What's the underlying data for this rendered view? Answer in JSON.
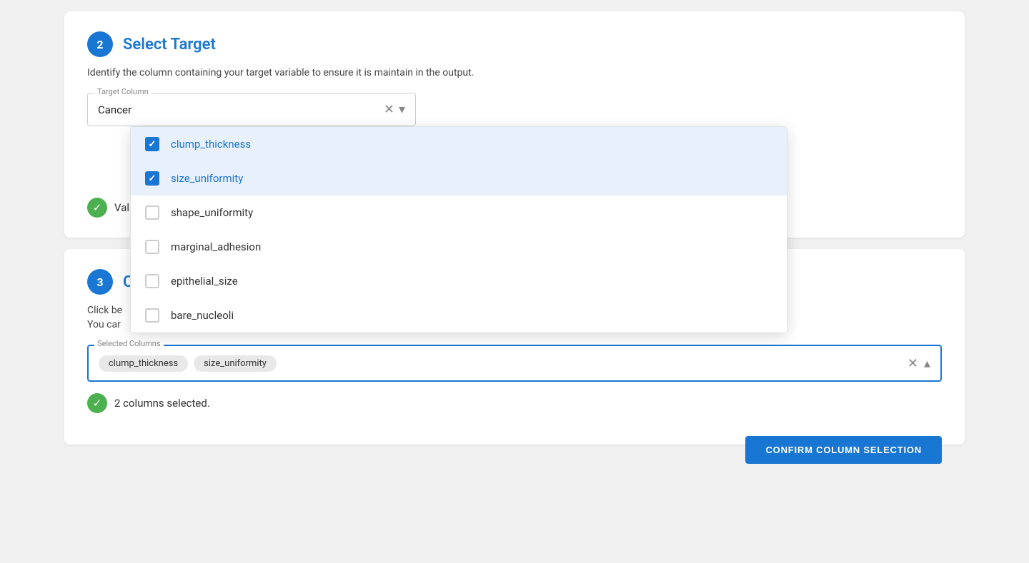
{
  "page": {
    "background": "#f0f0f0"
  },
  "section2": {
    "step_number": "2",
    "title": "Select Target",
    "description": "Identify the column containing your target variable to ensure it is maintain in the output.",
    "target_column_label": "Target Column",
    "target_column_value": "Cancer",
    "validation_text": "Val"
  },
  "dropdown": {
    "items": [
      {
        "id": "clump_thickness",
        "label": "clump_thickness",
        "checked": true
      },
      {
        "id": "size_uniformity",
        "label": "size_uniformity",
        "checked": true
      },
      {
        "id": "shape_uniformity",
        "label": "shape_uniformity",
        "checked": false
      },
      {
        "id": "marginal_adhesion",
        "label": "marginal_adhesion",
        "checked": false
      },
      {
        "id": "epithelial_size",
        "label": "epithelial_size",
        "checked": false
      },
      {
        "id": "bare_nucleoli",
        "label": "bare_nucleoli",
        "checked": false
      }
    ]
  },
  "section3": {
    "step_number": "3",
    "title_partial": "C",
    "click_desc1": "Click be",
    "click_desc2": "You car",
    "selected_columns_label": "Selected Columns",
    "tags": [
      "clump_thickness",
      "size_uniformity"
    ],
    "columns_selected_text": "2 columns selected.",
    "confirm_button_label": "CONFIRM COLUMN SELECTION"
  }
}
